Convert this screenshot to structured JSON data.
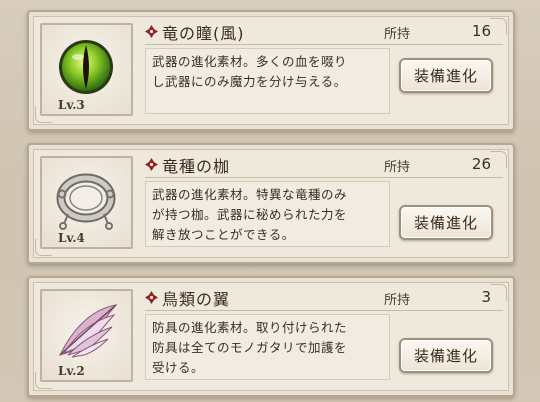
{
  "items": [
    {
      "name": "竜の瞳(風)",
      "level": "Lv.3",
      "own_label": "所持",
      "own_count": "16",
      "description_lines": [
        "武器の進化素材。多くの血を啜り",
        "し武器にのみ魔力を分け与える。"
      ],
      "button_label": "装備進化",
      "icon": "green-dragon-eye-icon"
    },
    {
      "name": "竜種の枷",
      "level": "Lv.4",
      "own_label": "所持",
      "own_count": "26",
      "description_lines": [
        "武器の進化素材。特異な竜種のみ",
        "が持つ枷。武器に秘められた力を",
        "解き放つことができる。"
      ],
      "button_label": "装備進化",
      "icon": "shackle-ring-icon"
    },
    {
      "name": "鳥類の翼",
      "level": "Lv.2",
      "own_label": "所持",
      "own_count": "3",
      "description_lines": [
        "防具の進化素材。取り付けられた",
        "防具は全てのモノガタリで加護を",
        "受ける。"
      ],
      "button_label": "装備進化",
      "icon": "pink-wing-icon"
    }
  ],
  "colors": {
    "diamond": "#8e2323",
    "text": "#3c2e22",
    "panel": "#efe8dd"
  }
}
